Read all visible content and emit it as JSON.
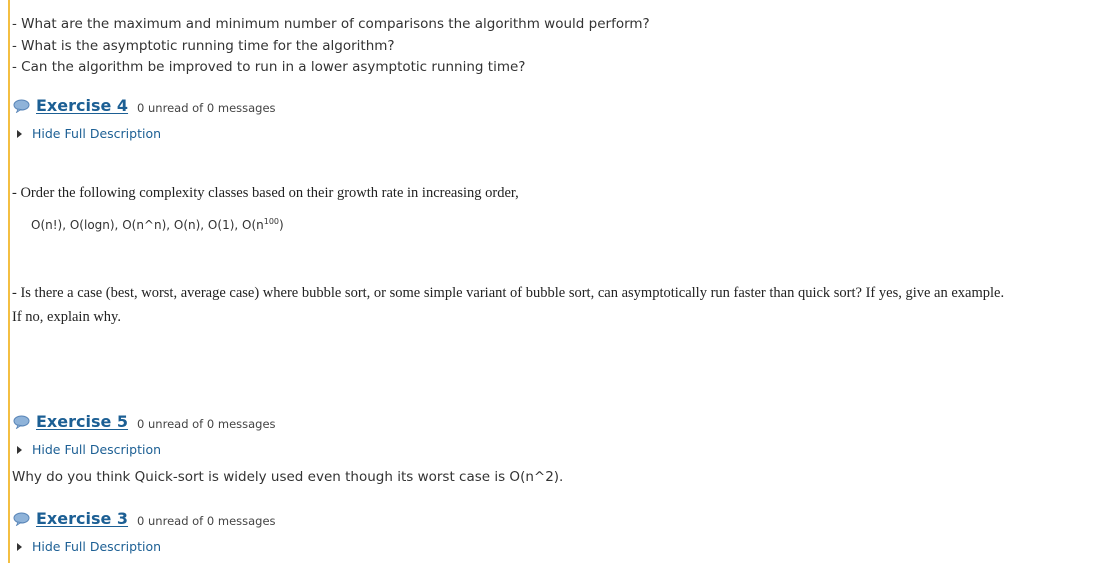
{
  "questions": [
    "- What are the maximum and minimum number of comparisons the algorithm would perform?",
    "- What is the asymptotic running time for the algorithm?",
    "- Can the algorithm be improved to run in a lower asymptotic running time?"
  ],
  "exercises": [
    {
      "title": "Exercise 4",
      "unread": "0 unread of 0 messages",
      "toggle_label": "Hide Full Description"
    },
    {
      "title": "Exercise 5",
      "unread": "0 unread of 0 messages",
      "toggle_label": "Hide Full Description"
    },
    {
      "title": "Exercise 3",
      "unread": "0 unread of 0 messages",
      "toggle_label": "Hide Full Description"
    }
  ],
  "exercise4": {
    "para1": "- Order the following complexity classes based on their growth rate in increasing order,",
    "classes_text": "O(n!), O(logn), O(n^n), O(n), O(1), O(n",
    "classes_exponent": "100",
    "classes_close": ")",
    "para2_line1": "-  Is there a case (best, worst, average case) where bubble sort, or some simple variant of bubble sort, can asymptotically run faster than quick sort? If yes, give an example.",
    "para2_line2": "If no, explain why."
  },
  "exercise5": {
    "description": "Why do you think Quick-sort is widely used even though its worst case is O(n^2)."
  },
  "colors": {
    "accent_bar": "#f4bf42",
    "link": "#1c5f94",
    "icon_fill": "#8fb3d9"
  },
  "icons": {
    "discussion": "speech-bubble-icon",
    "toggle": "triangle-right-icon"
  }
}
